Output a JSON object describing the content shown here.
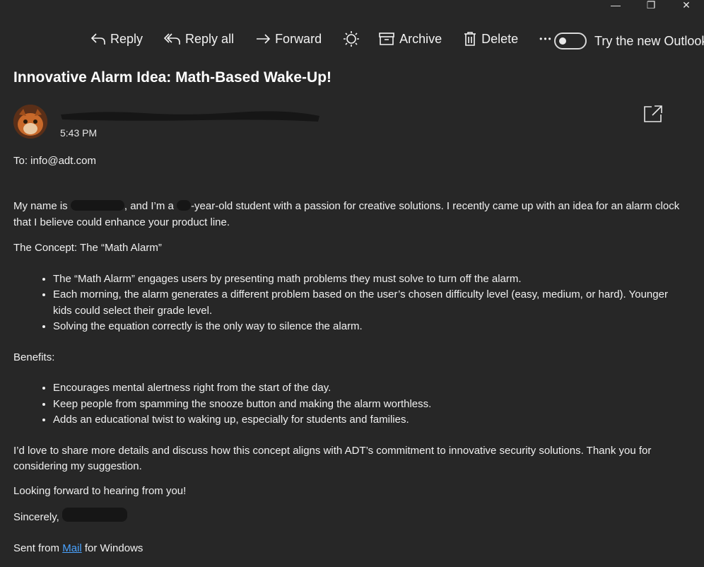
{
  "window": {
    "minimize": "—",
    "restore": "❐",
    "close": "✕"
  },
  "toolbar": {
    "reply": "Reply",
    "reply_all": "Reply all",
    "forward": "Forward",
    "archive": "Archive",
    "delete": "Delete",
    "more": "•••",
    "toggle_label": "Try the new Outlook"
  },
  "message": {
    "subject": "Innovative Alarm Idea: Math-Based Wake-Up!",
    "time": "5:43 PM",
    "to": "To: info@adt.com"
  },
  "body": {
    "intro_a": "My name is ",
    "intro_b": ", and I’m a ",
    "intro_c": "-year-old student with a passion for creative solutions. I recently came up with an idea for an alarm clock that I believe could enhance your product line.",
    "concept": "The Concept: The “Math Alarm”",
    "concept_items": [
      "The “Math Alarm” engages users by presenting math problems they must solve to turn off the alarm.",
      "Each morning, the alarm generates a different problem based on the user’s chosen difficulty level (easy, medium, or hard). Younger kids could select their grade level.",
      "Solving the equation correctly is the only way to silence the alarm."
    ],
    "benefits": "Benefits:",
    "benefit_items": [
      "Encourages mental alertness right from the start of the day.",
      "Keep people from spamming the snooze button and making the alarm worthless.",
      "Adds an educational twist to waking up, especially for students and families."
    ],
    "closing": "I’d love to share more details and discuss how this concept aligns with ADT’s commitment to innovative security solutions. Thank you for considering my suggestion.",
    "looking": "Looking forward to hearing from you!",
    "sincerely": "Sincerely,",
    "sent_a": "Sent from ",
    "sent_link": "Mail",
    "sent_b": " for Windows"
  },
  "colors": {
    "background": "#272727",
    "text": "#f0f0f0",
    "link": "#4aa3ff"
  }
}
